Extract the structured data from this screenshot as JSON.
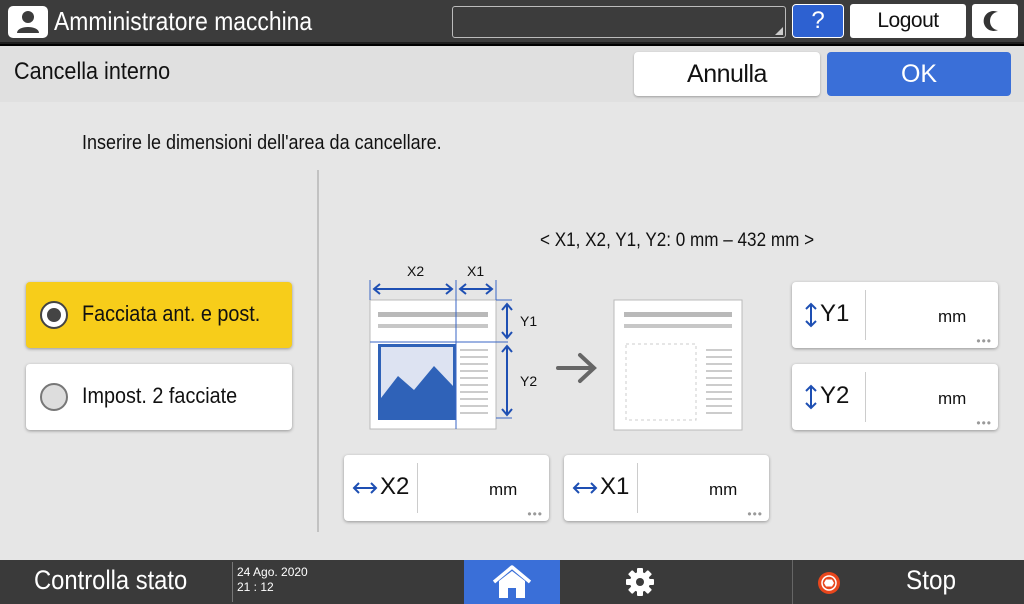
{
  "header": {
    "user_title": "Amministratore macchina",
    "help_label": "?",
    "logout_label": "Logout"
  },
  "subheader": {
    "title": "Cancella interno",
    "cancel_label": "Annulla",
    "ok_label": "OK"
  },
  "main": {
    "instruction": "Inserire le dimensioni dell'area da cancellare.",
    "range_text": "< X1, X2, Y1, Y2: 0 mm – 432 mm >",
    "options": [
      {
        "label": "Facciata ant. e post.",
        "selected": true
      },
      {
        "label": "Impost. 2 facciate",
        "selected": false
      }
    ],
    "diagram": {
      "x1_label": "X1",
      "x2_label": "X2",
      "y1_label": "Y1",
      "y2_label": "Y2"
    },
    "fields": {
      "y1": {
        "label": "Y1",
        "unit": "mm",
        "dots": "•••"
      },
      "y2": {
        "label": "Y2",
        "unit": "mm",
        "dots": "•••"
      },
      "x2": {
        "label": "X2",
        "unit": "mm",
        "dots": "•••"
      },
      "x1": {
        "label": "X1",
        "unit": "mm",
        "dots": "•••"
      }
    }
  },
  "footer": {
    "status_label": "Controlla stato",
    "date": "24 Ago. 2020",
    "time": "21 : 12",
    "stop_label": "Stop"
  },
  "colors": {
    "accent_blue": "#3a6fd8",
    "selected_yellow": "#f7cd1a",
    "topbar": "#3c3c3c",
    "stop_red": "#e8461c"
  },
  "icons": {
    "user": "user-icon",
    "night": "moon-icon",
    "home": "home-icon",
    "settings": "gear-icon",
    "stop": "stop-icon",
    "arrow": "arrow-right-icon"
  }
}
